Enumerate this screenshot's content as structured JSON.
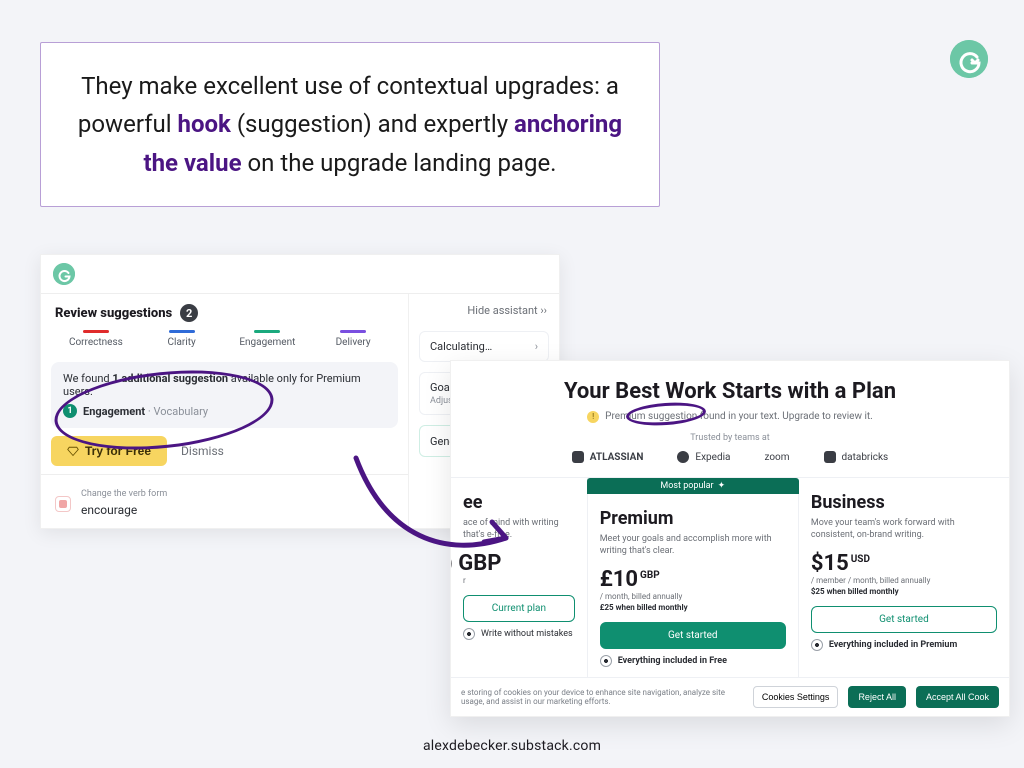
{
  "callout": {
    "pre": "They make excellent use of contextual upgrades: a powerful ",
    "hook_bold": "hook",
    "mid1": " (suggestion) and expertly ",
    "anchor_bold": "anchoring the value",
    "post": " on the upgrade landing page."
  },
  "shot1": {
    "hide_assistant": "Hide assistant ››",
    "review_title": "Review suggestions",
    "review_count": "2",
    "tabs": {
      "correctness": "Correctness",
      "clarity": "Clarity",
      "engagement": "Engagement",
      "delivery": "Delivery"
    },
    "promo": {
      "line_pre": "We found ",
      "line_bold": "1 additional suggestion",
      "line_post": " available only for Premium users.",
      "tag_number": "1",
      "tag_main": "Engagement",
      "tag_sub": " · Vocabulary"
    },
    "try_label": "Try for Free",
    "dismiss": "Dismiss",
    "mini": {
      "title": "Change the verb form",
      "word": "encourage"
    },
    "side": {
      "calculating": "Calculating…",
      "goals": "Goals",
      "goals_sub": "Adjust goals",
      "gen": "Generative AI"
    }
  },
  "shot2": {
    "title": "Your Best Work Starts with a Plan",
    "sub": "Premium suggestion found in your text. Upgrade to review it.",
    "trusted": "Trusted by teams at",
    "logos": {
      "atlassian": "ATLASSIAN",
      "expedia": "Expedia",
      "zoom": "zoom",
      "databricks": "databricks"
    },
    "most_popular": "Most popular",
    "plans": {
      "free": {
        "name": "ee",
        "desc": "ace of mind with writing that's e-free.",
        "price": ") GBP",
        "sub1": "r",
        "btn": "Current plan",
        "feat1": "Write without mistakes"
      },
      "premium": {
        "name": "Premium",
        "desc": "Meet your goals and accomplish more with writing that's clear.",
        "price": "£10",
        "currency": "GBP",
        "sub1": "/ month, billed annually",
        "sub2": "£25 when billed monthly",
        "btn": "Get started",
        "feat1": "Everything included in Free"
      },
      "business": {
        "name": "Business",
        "desc": "Move your team's work forward with consistent, on-brand writing.",
        "price": "$15",
        "currency": "USD",
        "sub1": "/ member / month, billed annually",
        "sub2": "$25 when billed monthly",
        "btn": "Get started",
        "feat1": "Everything included in Premium"
      }
    },
    "cookie": {
      "msg": "e storing of cookies on your device to enhance site navigation, analyze site usage, and assist in our marketing efforts.",
      "settings": "Cookies Settings",
      "reject": "Reject All",
      "accept": "Accept All Cook"
    }
  },
  "attribution": "alexdebecker.substack.com"
}
